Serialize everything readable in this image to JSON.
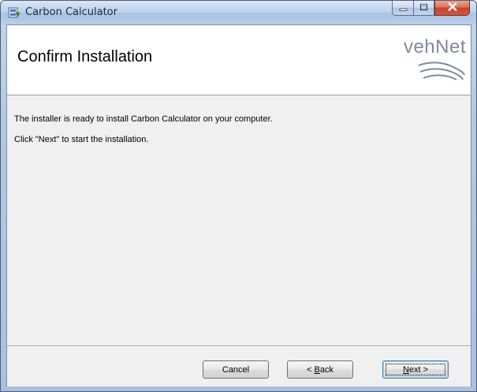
{
  "window": {
    "title": "Carbon Calculator"
  },
  "banner": {
    "title": "Confirm Installation",
    "logo_text": "vehNet"
  },
  "body": {
    "line1": "The installer is ready to install Carbon Calculator on your computer.",
    "line2": "Click \"Next\" to start the installation."
  },
  "buttons": {
    "cancel": "Cancel",
    "back_prefix": "< ",
    "back_accel": "B",
    "back_rest": "ack",
    "next_accel": "N",
    "next_rest": "ext >"
  },
  "colors": {
    "logo": "#7f8a9c",
    "close_button": "#c4442a"
  },
  "icons": {
    "app": "installer-icon",
    "minimize": "minimize-icon",
    "maximize": "maximize-icon",
    "close": "close-icon",
    "logo_waves": "wave-logo-icon"
  }
}
